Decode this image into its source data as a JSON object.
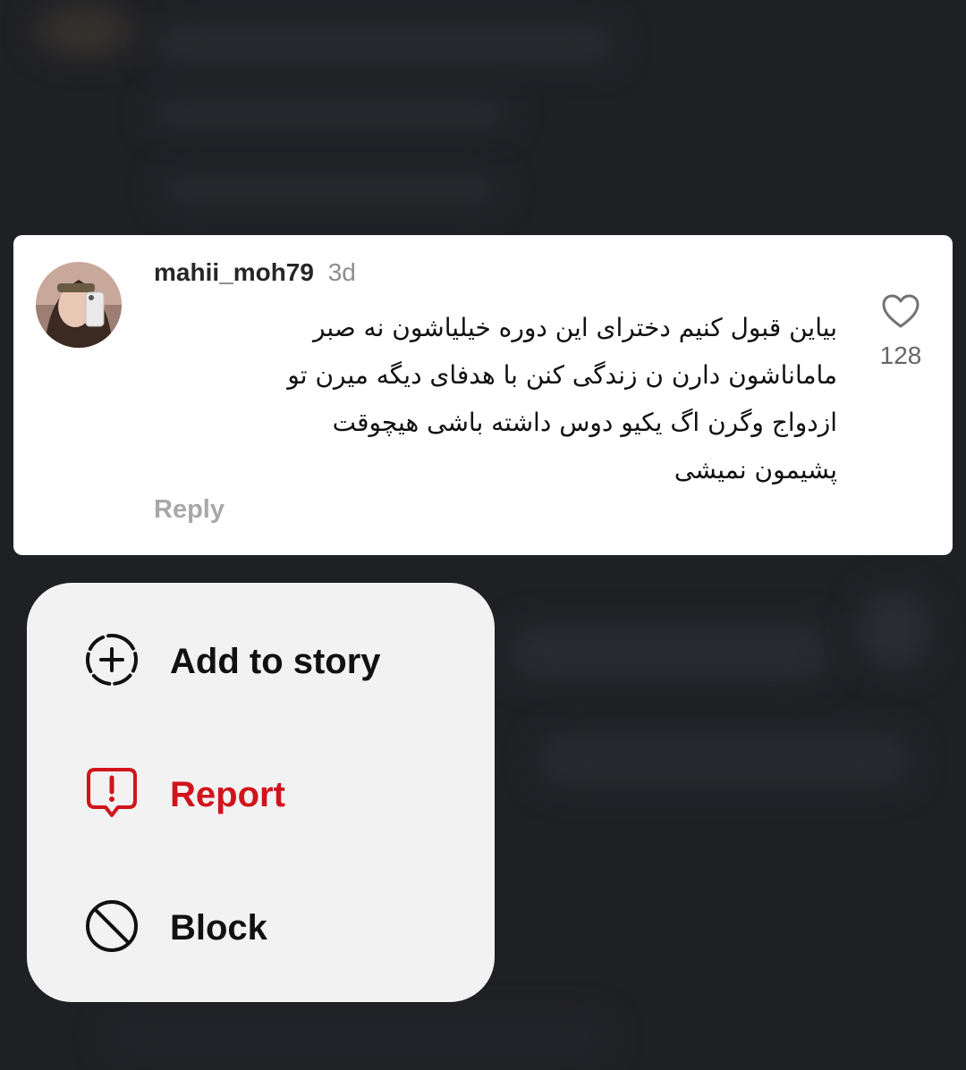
{
  "comment": {
    "author": "mahii_moh79",
    "timestamp": "3d",
    "text_lines": [
      "بیاین قبول کنیم دخترای این دوره خیلیاشون نه صبر",
      "ماماناشون دارن ن زندگی کنن با هدفای دیگه میرن تو",
      "ازدواج وگرن اگ یکیو دوس داشته باشی هیچوقت",
      "پشیمون نمیشی"
    ],
    "reply_label": "Reply",
    "like_count": "128",
    "like_icon": "heart-outline-icon",
    "avatar": "profile-photo"
  },
  "menu": {
    "items": [
      {
        "label": "Add to story",
        "icon": "add-to-story-icon",
        "color": "#111111"
      },
      {
        "label": "Report",
        "icon": "report-icon",
        "color": "#d1131c"
      },
      {
        "label": "Block",
        "icon": "block-icon",
        "color": "#111111"
      }
    ]
  },
  "colors": {
    "backdrop": "#1f2024",
    "card": "#ffffff",
    "menu": "#f2f2f2",
    "danger": "#d1131c",
    "muted": "#8e8e8e"
  }
}
